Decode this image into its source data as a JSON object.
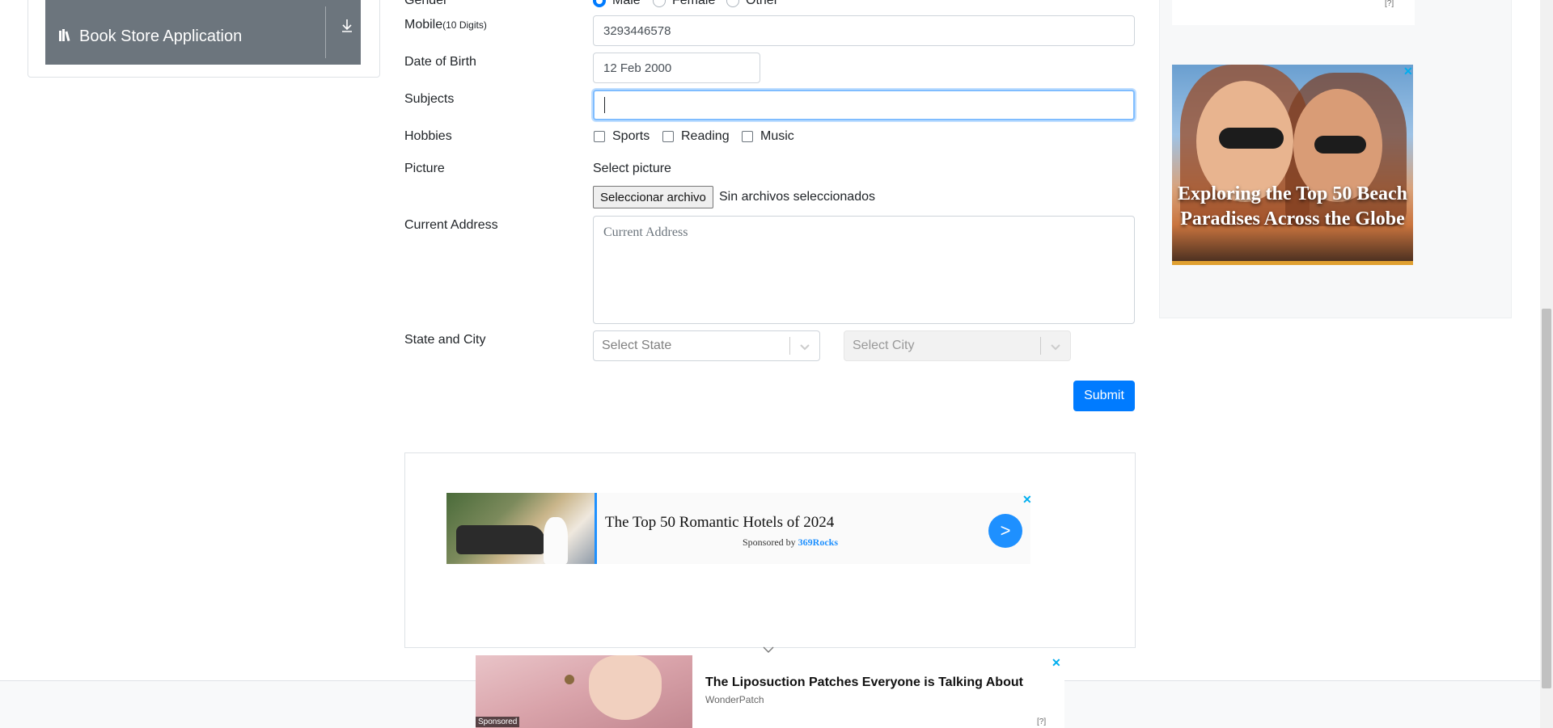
{
  "sidebar": {
    "book_store_label": "Book Store Application"
  },
  "form": {
    "gender": {
      "label": "Gender",
      "options": [
        "Male",
        "Female",
        "Other"
      ],
      "selected": "Male"
    },
    "mobile": {
      "label": "Mobile",
      "hint": "(10 Digits)",
      "value": "3293446578"
    },
    "dob": {
      "label": "Date of Birth",
      "value": "12 Feb 2000"
    },
    "subjects": {
      "label": "Subjects",
      "value": ""
    },
    "hobbies": {
      "label": "Hobbies",
      "options": [
        "Sports",
        "Reading",
        "Music"
      ]
    },
    "picture": {
      "label": "Picture",
      "helper": "Select picture",
      "button": "Seleccionar archivo",
      "status": "Sin archivos seleccionados"
    },
    "address": {
      "label": "Current Address",
      "placeholder": "Current Address"
    },
    "state_city": {
      "label": "State and City",
      "state_placeholder": "Select State",
      "city_placeholder": "Select City"
    },
    "submit_label": "Submit"
  },
  "ads": {
    "right": {
      "headline": "Exploring the Top 50 Beach Paradises Across the Globe",
      "close": "✕",
      "adchoices": "[?]"
    },
    "middle": {
      "title": "The Top 50 Romantic Hotels of 2024",
      "sponsor_prefix": "Sponsored by",
      "sponsor_brand": "369Rocks",
      "arrow": ">",
      "close": "✕"
    },
    "bottom": {
      "title": "The Liposuction Patches Everyone is Talking About",
      "brand": "WonderPatch",
      "sponsored": "Sponsored",
      "adchoices": "[?]",
      "close": "✕"
    }
  },
  "colors": {
    "primary": "#007bff",
    "sidebar_button": "#6c757d",
    "focus_border": "#80bdff"
  }
}
